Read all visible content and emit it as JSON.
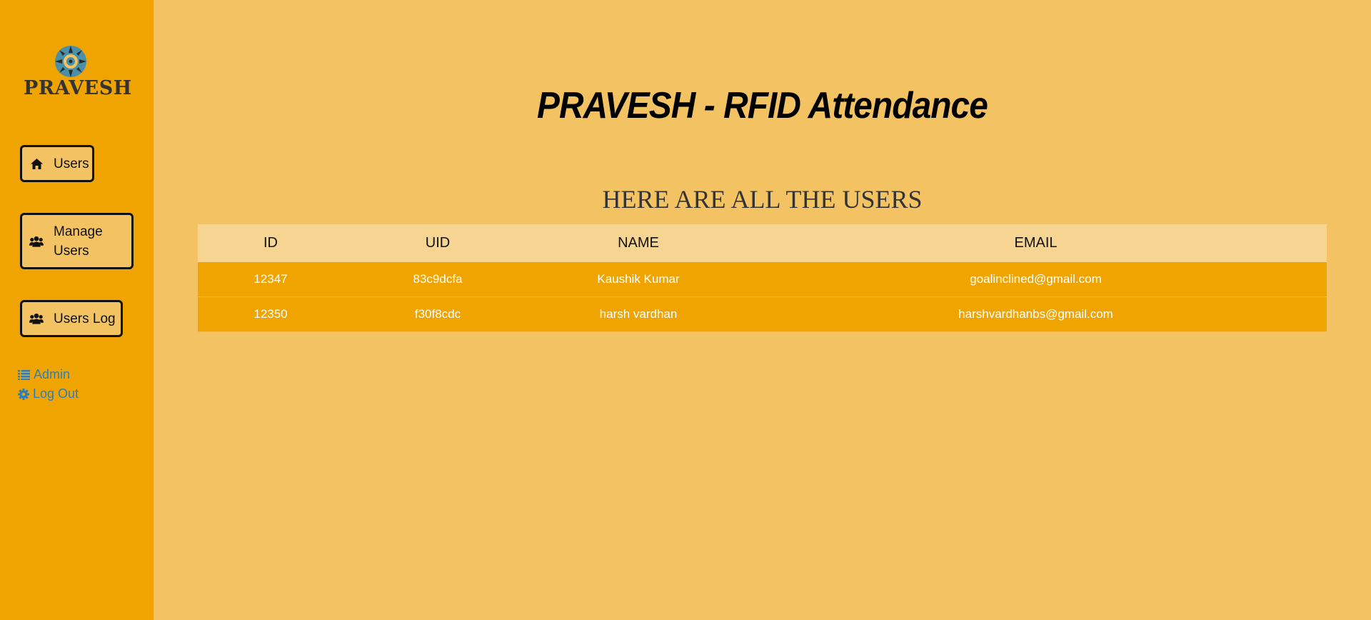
{
  "brand": {
    "logo_text": "PRAVESH",
    "accent": "#efa401",
    "background": "#f3c363"
  },
  "sidebar": {
    "buttons": [
      {
        "label": "Users",
        "icon": "home-icon"
      },
      {
        "label": "Manage Users",
        "icon": "users-group-icon"
      },
      {
        "label": "Users Log",
        "icon": "users-group-icon"
      }
    ],
    "links": [
      {
        "label": "Admin",
        "icon": "list-icon"
      },
      {
        "label": "Log Out",
        "icon": "gear-icon"
      }
    ]
  },
  "main": {
    "title": "PRAVESH - RFID Attendance",
    "section_title": "HERE ARE ALL THE USERS",
    "table": {
      "headers": [
        "ID",
        "UID",
        "NAME",
        "EMAIL"
      ],
      "rows": [
        [
          "12347",
          "83c9dcfa",
          "Kaushik Kumar",
          "goalinclined@gmail.com"
        ],
        [
          "12350",
          "f30f8cdc",
          "harsh vardhan",
          "harshvardhanbs@gmail.com"
        ]
      ]
    }
  }
}
